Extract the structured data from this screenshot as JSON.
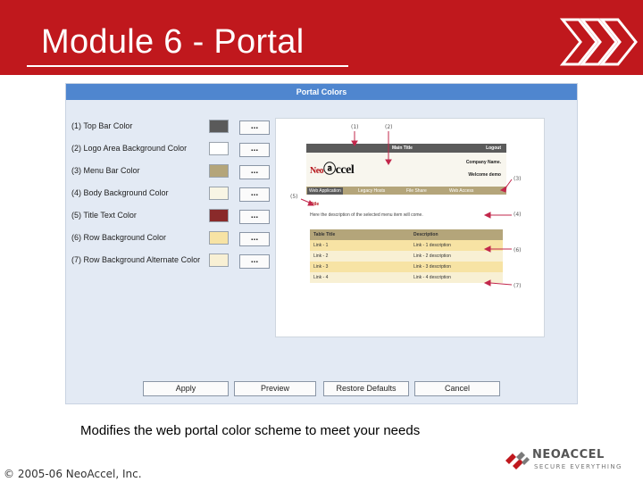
{
  "slide": {
    "title": "Module 6 - Portal",
    "caption": "Modifies the web portal color scheme to meet your needs",
    "copyright": "© 2005-06 NeoAccel, Inc."
  },
  "brand": {
    "name": "NEOACCEL",
    "tagline": "SECURE EVERYTHING",
    "accent": "#c0181d"
  },
  "dialog": {
    "title": "Portal Colors",
    "browse_label": "...",
    "color_rows": [
      {
        "label": "(1) Top Bar Color",
        "color": "#5a5a5a"
      },
      {
        "label": "(2) Logo Area Background Color",
        "color": "#ffffff"
      },
      {
        "label": "(3) Menu Bar Color",
        "color": "#b4a57a"
      },
      {
        "label": "(4) Body Background Color",
        "color": "#f8f5e4"
      },
      {
        "label": "(5) Title Text Color",
        "color": "#8a2a2a"
      },
      {
        "label": "(6) Row Background Color",
        "color": "#f7e3a4"
      },
      {
        "label": "(7) Row Background Alternate Color",
        "color": "#f8f0d4"
      }
    ],
    "buttons": {
      "apply": "Apply",
      "preview": "Preview",
      "restore": "Restore Defaults",
      "cancel": "Cancel"
    }
  },
  "preview": {
    "main_title": "Main Title",
    "logout": "Logout",
    "company_name": "Company Name.",
    "welcome": "Welcome demo",
    "logo_neo": "Neo",
    "logo_accel": "ccel",
    "tabs": [
      "Web Application",
      "Legacy Hosts",
      "File Share",
      "Web Access"
    ],
    "title_text": "Title",
    "description_text": "Here the description of the selected menu item will come.",
    "table_headers": [
      "Table Title",
      "Description"
    ],
    "table_rows": [
      [
        "Link - 1",
        "Link - 1 description"
      ],
      [
        "Link - 2",
        "Link - 2 description"
      ],
      [
        "Link - 3",
        "Link - 3 description"
      ],
      [
        "Link - 4",
        "Link - 4 description"
      ]
    ],
    "annotations": [
      "(1)",
      "(2)",
      "(3)",
      "(4)",
      "(5)",
      "(6)",
      "(7)"
    ]
  }
}
